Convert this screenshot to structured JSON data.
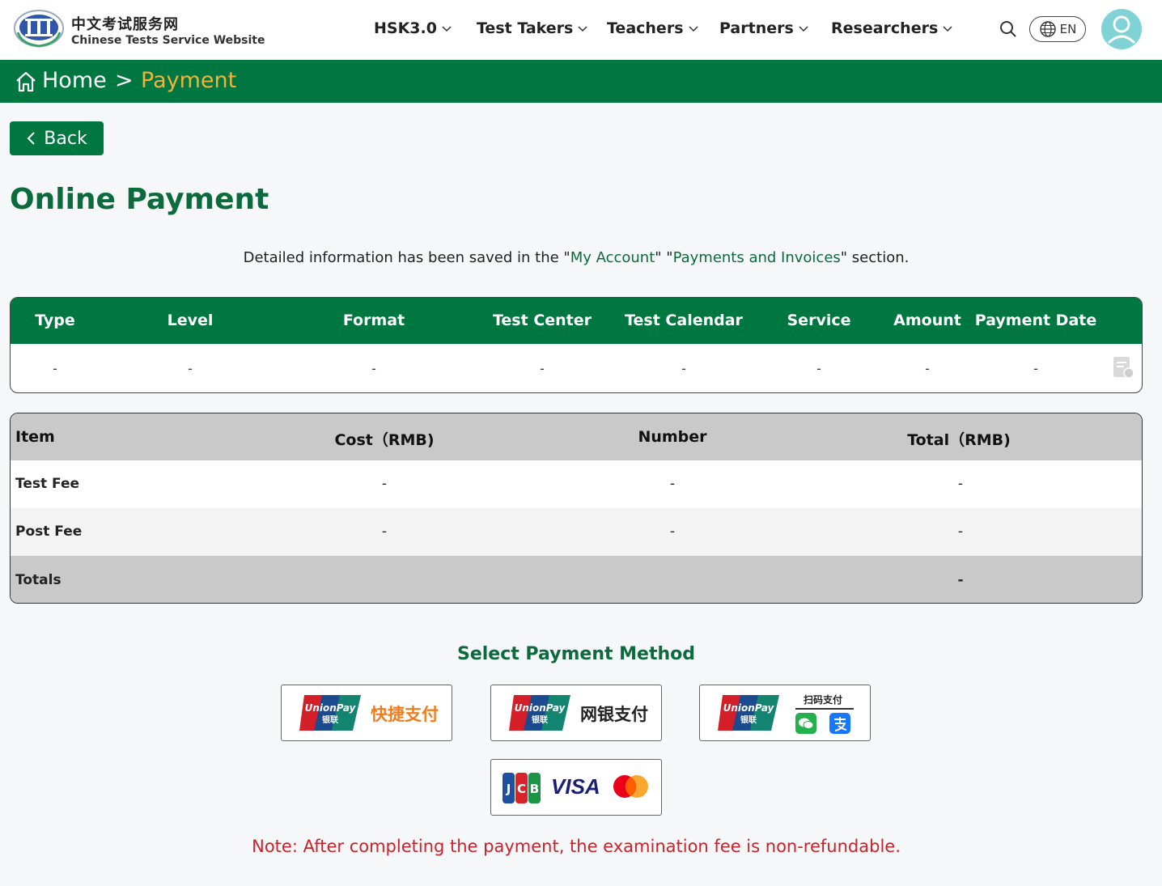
{
  "header": {
    "brand_cn": "中文考试服务网",
    "brand_en": "Chinese Tests Service Website",
    "nav": [
      "HSK3.0",
      "Test Takers",
      "Teachers",
      "Partners",
      "Researchers"
    ],
    "lang": "EN"
  },
  "breadcrumb": {
    "home": "Home",
    "separator": ">",
    "current": "Payment"
  },
  "back_label": "Back",
  "page_title": "Online Payment",
  "info": {
    "prefix": "Detailed information has been saved in the \"",
    "link1": "My Account",
    "middle": "\" \"",
    "link2": "Payments and Invoices",
    "suffix": "\" section."
  },
  "order_table": {
    "headers": [
      "Type",
      "Level",
      "Format",
      "Test Center",
      "Test Calendar",
      "Service",
      "Amount",
      "Payment Date"
    ],
    "row": [
      "-",
      "-",
      "-",
      "-",
      "-",
      "-",
      "-",
      "-"
    ]
  },
  "fee_table": {
    "headers": [
      "Item",
      "Cost（RMB)",
      "Number",
      "Total（RMB)"
    ],
    "rows": [
      {
        "item": "Test Fee",
        "cost": "-",
        "number": "-",
        "total": "-"
      },
      {
        "item": "Post Fee",
        "cost": "-",
        "number": "-",
        "total": "-"
      }
    ],
    "totals_label": "Totals",
    "totals_value": "-"
  },
  "payment": {
    "title": "Select Payment Method",
    "methods": {
      "quick": "快捷支付",
      "netbank": "网银支付",
      "scan": "扫码支付",
      "cards": "VISA"
    }
  },
  "note": "Note: After completing the payment, the examination fee is non-refundable.",
  "colors": {
    "primary_green": "#007640",
    "accent_orange": "#f2b33d",
    "note_red": "#c8232c"
  }
}
